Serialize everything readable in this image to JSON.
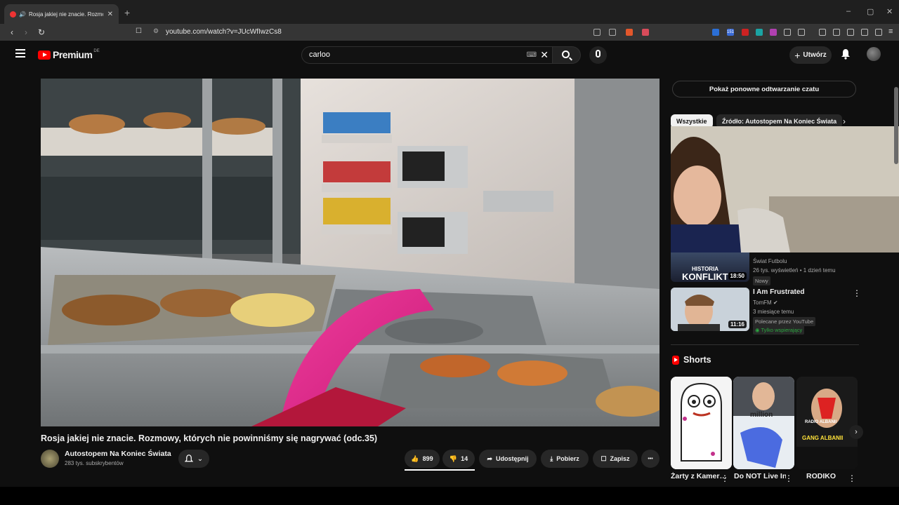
{
  "browser": {
    "tab_title": "Rosja jakiej nie znacie. Rozmo",
    "tab_close": "✕",
    "new_tab": "+",
    "url": "youtube.com/watch?v=JUcWfIwzCs8",
    "window_controls": [
      "–",
      "▢",
      "✕"
    ],
    "extension_badge": "151"
  },
  "header": {
    "logo_text": "Premium",
    "logo_region": "DE",
    "search_value": "carloo",
    "create_label": "Utwórz"
  },
  "video": {
    "title": "Rosja jakiej nie znacie. Rozmowy, których nie powinniśmy się nagrywać (odc.35)",
    "channel_name": "Autostopem Na Koniec Świata",
    "channel_subs": "283 tys. subskrybentów",
    "likes": "899",
    "dislikes": "14",
    "share_label": "Udostępnij",
    "download_label": "Pobierz",
    "save_label": "Zapisz",
    "more_label": "•••"
  },
  "sidebar": {
    "chat_replay_label": "Pokaż ponowne odtwarzanie czatu",
    "chips": [
      "Wszystkie",
      "Źródło: Autostopem Na Koniec Świata"
    ],
    "recommendations": [
      {
        "thumb_text_top": "HISTORIA",
        "thumb_text": "KONFLIKT",
        "duration": "18:50",
        "channel": "Świat Futbolu",
        "meta": "26 tys. wyświetleń • 1 dzień temu",
        "badge": "Nowy"
      },
      {
        "title": "I Am Frustrated",
        "channel": "TomFM ✔",
        "meta": "3 miesiące temu",
        "duration": "11:16",
        "badge": "Polecane przez YouTube",
        "member_badge": "Tylko wspierający"
      }
    ],
    "shorts_heading": "Shorts",
    "shorts": [
      {
        "title": "Żarty z Kamer…",
        "overlay": ""
      },
      {
        "title": "Do NOT Live In The Blue",
        "overlay": "million"
      },
      {
        "title": "RODIKO",
        "overlay": "GANG ALBANII",
        "top_label": "RADIO ALBANII"
      }
    ]
  },
  "colors": {
    "background": "#0f0f0f",
    "brand_red": "#ff0000",
    "member_green": "#2ba640"
  }
}
